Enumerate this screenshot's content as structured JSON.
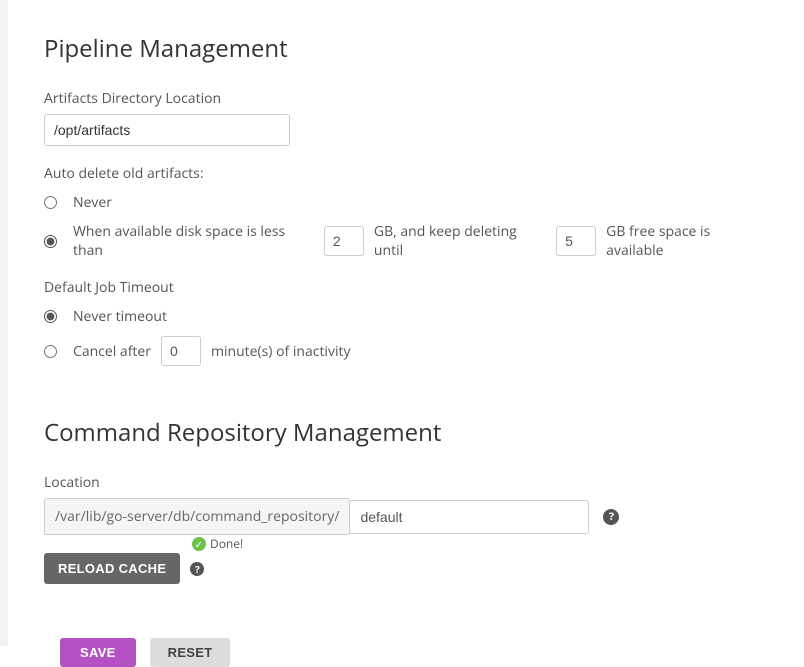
{
  "pipeline": {
    "title": "Pipeline Management",
    "artifacts_label": "Artifacts Directory Location",
    "artifacts_value": "/opt/artifacts",
    "auto_delete_label": "Auto delete old artifacts:",
    "never_label": "Never",
    "when_prefix": "When available disk space is less than",
    "when_threshold": "2",
    "gb_mid": "GB, and keep deleting until",
    "when_target": "5",
    "gb_suffix": "GB free space is available",
    "timeout_label": "Default Job Timeout",
    "never_timeout_label": "Never timeout",
    "cancel_prefix": "Cancel after",
    "cancel_minutes": "0",
    "cancel_suffix": "minute(s) of inactivity"
  },
  "cmdrepo": {
    "title": "Command Repository Management",
    "location_label": "Location",
    "prefix_path": "/var/lib/go-server/db/command_repository/",
    "value": "default",
    "reload_label": "RELOAD CACHE",
    "done_label": "Done!"
  },
  "actions": {
    "save": "SAVE",
    "reset": "RESET"
  },
  "icons": {
    "help": "?",
    "check": "✓"
  }
}
